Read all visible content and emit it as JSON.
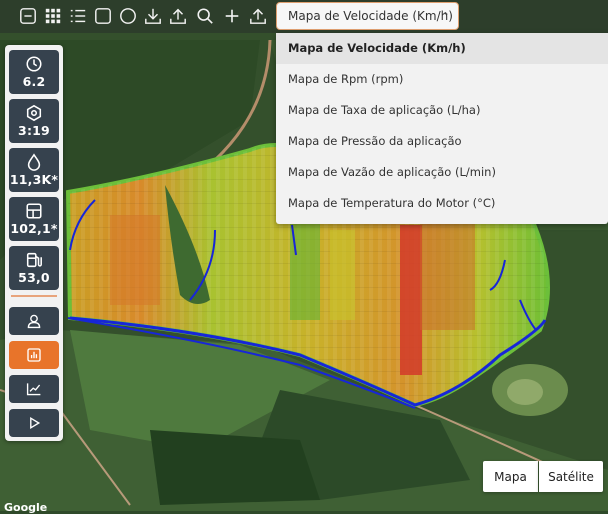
{
  "toolbar": {
    "icons": [
      "minus-square-icon",
      "grid-icon",
      "list-icon",
      "square-icon",
      "circle-icon",
      "download-icon",
      "upload-icon",
      "search-icon",
      "plus-icon",
      "upload-icon"
    ]
  },
  "map_select": {
    "selected": "Mapa de Velocidade (Km/h)",
    "options": [
      "Mapa de Velocidade (Km/h)",
      "Mapa de Rpm (rpm)",
      "Mapa de Taxa de aplicação (L/ha)",
      "Mapa de Pressão da aplicação",
      "Mapa de Vazão de aplicação (L/min)",
      "Mapa de Temperatura do Motor (°C)"
    ]
  },
  "stats": [
    {
      "icon": "clock-icon",
      "value": "6.2"
    },
    {
      "icon": "hexagon-icon",
      "value": "3:19"
    },
    {
      "icon": "drop-icon",
      "value": "11,3K*"
    },
    {
      "icon": "area-icon",
      "value": "102,1*"
    },
    {
      "icon": "fuel-icon",
      "value": "53,0"
    }
  ],
  "panel_buttons": [
    "user-icon",
    "bar-chart-icon",
    "line-chart-icon",
    "play-icon"
  ],
  "map_type": {
    "map": "Mapa",
    "satellite": "Satélite"
  },
  "attribution": "Google",
  "colors": {
    "accent": "#e8742a",
    "panel_button": "#36424e",
    "route": "#1726d8"
  }
}
